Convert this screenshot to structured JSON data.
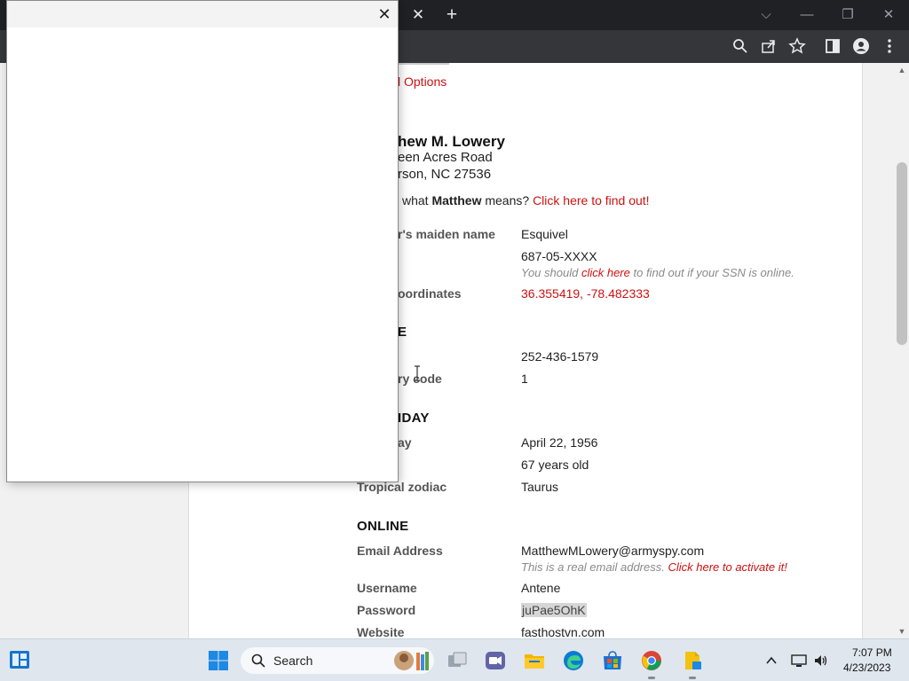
{
  "tab": {
    "close_label": "✕",
    "new_tab_label": "+"
  },
  "window_controls": {
    "dropdown": "⌵",
    "minimize": "—",
    "restore": "❐",
    "close": "✕"
  },
  "page": {
    "options_link": "l Options",
    "person": {
      "name": "hew M. Lowery",
      "street": "een Acres Road",
      "city": "rson, NC 27536"
    },
    "meaning": {
      "prefix": "what ",
      "name": "Matthew",
      "middle": " means? ",
      "link": "Click here to find out!"
    },
    "rows": {
      "maiden_label": "r's maiden name",
      "maiden_value": "Esquivel",
      "ssn_value": "687-05-XXXX",
      "ssn_note_prefix": "You should ",
      "ssn_note_link": "click here",
      "ssn_note_suffix": " to find out if your SSN is online.",
      "geo_label": "oordinates",
      "geo_value": "36.355419, -78.482333",
      "phone_section": "E",
      "phone_value": "252-436-1579",
      "country_label": "ry code",
      "country_value": "1",
      "birthday_section": "IDAY",
      "birthday_label": "ay",
      "birthday_value": "April 22, 1956",
      "age_value": "67 years old",
      "zodiac_label": "Tropical zodiac",
      "zodiac_value": "Taurus",
      "online_section": "ONLINE",
      "email_label": "Email Address",
      "email_value": "MatthewMLowery@armyspy.com",
      "email_note_prefix": "This is a real email address. ",
      "email_note_link": "Click here to activate it!",
      "username_label": "Username",
      "username_value": "Antene",
      "password_label": "Password",
      "password_value": "juPae5OhK",
      "website_label": "Website",
      "website_value": "fasthostvn.com"
    }
  },
  "popup": {
    "close_label": "✕"
  },
  "taskbar": {
    "search_label": "Search",
    "clock_time": "7:07 PM",
    "clock_date": "4/23/2023"
  },
  "colors": {
    "link_red": "#cc1111",
    "chrome_dark": "#202124",
    "toolbar_gray": "#35363a",
    "taskbar_bg": "#dfe6ee"
  }
}
